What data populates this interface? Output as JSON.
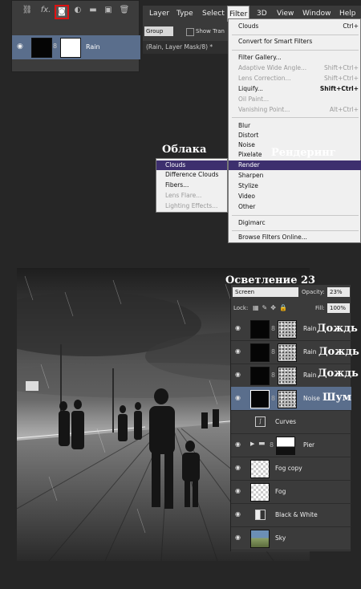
{
  "mini_panel": {
    "tools": [
      "link-icon",
      "fx-icon",
      "add-mask-icon",
      "adjustment-icon",
      "folder-icon",
      "new-layer-icon",
      "trash-icon"
    ],
    "fx_label": "fx.",
    "layer_name": "Rain"
  },
  "menubar": {
    "items": [
      "Layer",
      "Type",
      "Select",
      "Filter",
      "3D",
      "View",
      "Window",
      "Help"
    ]
  },
  "options_bar": {
    "group_value": "Group",
    "show_transform": "Show Tran"
  },
  "doc_tab": "(Rain, Layer Mask/8) *",
  "filter_menu": {
    "items": [
      {
        "label": "Clouds",
        "shortcut": "Ctrl+",
        "disabled": false
      },
      {
        "label": "Convert for Smart Filters",
        "shortcut": "",
        "disabled": false
      },
      {
        "label": "Filter Gallery...",
        "shortcut": "",
        "disabled": false
      },
      {
        "label": "Adaptive Wide Angle...",
        "shortcut": "Shift+Ctrl+",
        "disabled": true
      },
      {
        "label": "Lens Correction...",
        "shortcut": "Shift+Ctrl+",
        "disabled": true
      },
      {
        "label": "Liquify...",
        "shortcut": "Shift+Ctrl+",
        "disabled": false
      },
      {
        "label": "Oil Paint...",
        "shortcut": "",
        "disabled": true
      },
      {
        "label": "Vanishing Point...",
        "shortcut": "Alt+Ctrl+",
        "disabled": true
      },
      {
        "label": "Blur",
        "shortcut": "",
        "disabled": false
      },
      {
        "label": "Distort",
        "shortcut": "",
        "disabled": false
      },
      {
        "label": "Noise",
        "shortcut": "",
        "disabled": false
      },
      {
        "label": "Pixelate",
        "shortcut": "",
        "disabled": false
      },
      {
        "label": "Render",
        "shortcut": "",
        "disabled": false
      },
      {
        "label": "Sharpen",
        "shortcut": "",
        "disabled": false
      },
      {
        "label": "Stylize",
        "shortcut": "",
        "disabled": false
      },
      {
        "label": "Video",
        "shortcut": "",
        "disabled": false
      },
      {
        "label": "Other",
        "shortcut": "",
        "disabled": false
      },
      {
        "label": "Digimarc",
        "shortcut": "",
        "disabled": false
      },
      {
        "label": "Browse Filters Online...",
        "shortcut": "",
        "disabled": false
      }
    ]
  },
  "render_submenu": {
    "items": [
      {
        "label": "Clouds",
        "disabled": false
      },
      {
        "label": "Difference Clouds",
        "disabled": false
      },
      {
        "label": "Fibers...",
        "disabled": false
      },
      {
        "label": "Lens Flare...",
        "disabled": true
      },
      {
        "label": "Lighting Effects...",
        "disabled": true
      }
    ]
  },
  "annotations": {
    "clouds": "Облака",
    "render": "Рендеринг",
    "screen_opacity": "Осветление     23",
    "rain_1": "Дождь",
    "rain_2": "Дождь",
    "rain_3": "Дождь",
    "noise": "Шум"
  },
  "layers_panel": {
    "blend_mode": "Screen",
    "opacity_label": "Opacity:",
    "opacity_value": "23%",
    "lock_label": "Lock:",
    "fill_label": "Fill:",
    "fill_value": "100%",
    "layers": [
      {
        "name": "Rain",
        "selected": false
      },
      {
        "name": "Rain",
        "selected": false
      },
      {
        "name": "Rain",
        "selected": false
      },
      {
        "name": "Noise",
        "selected": true
      },
      {
        "name": "Curves",
        "selected": false
      },
      {
        "name": "Pier",
        "selected": false
      },
      {
        "name": "Fog copy",
        "selected": false
      },
      {
        "name": "Fog",
        "selected": false
      },
      {
        "name": "Black & White",
        "selected": false
      },
      {
        "name": "Sky",
        "selected": false
      }
    ]
  }
}
